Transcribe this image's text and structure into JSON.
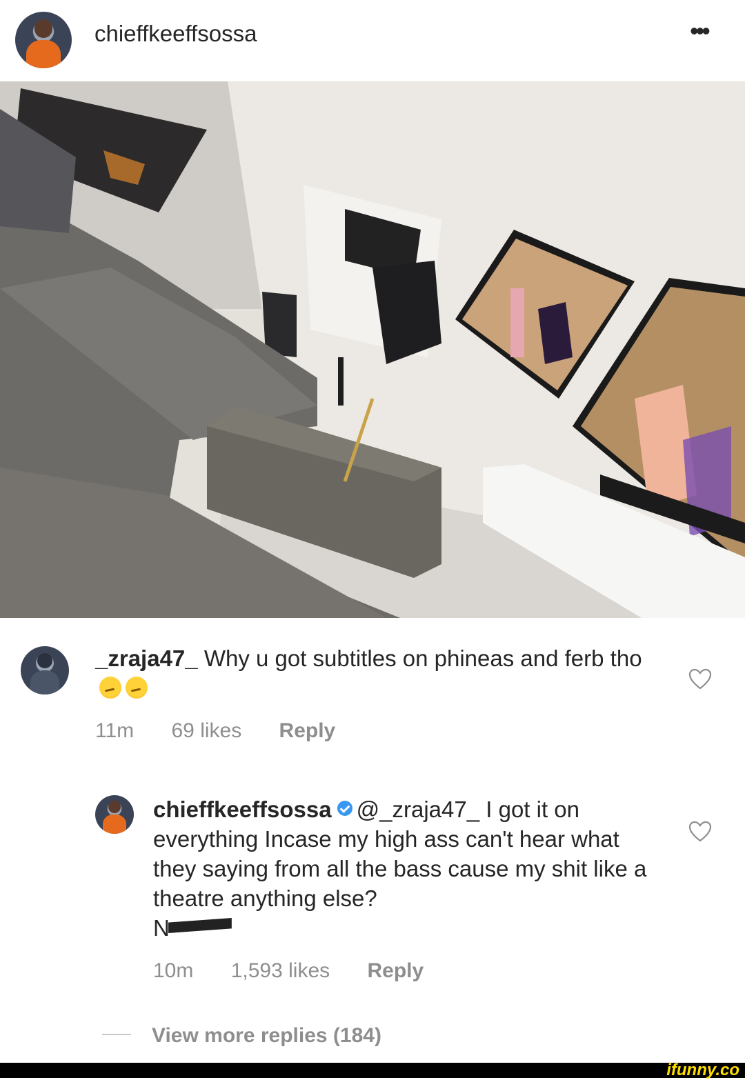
{
  "post": {
    "username": "chieffkeeffsossa",
    "more_label": "•••"
  },
  "comment1": {
    "username": "_zraja47_",
    "text": "Why u got subtitles on phineas and ferb tho",
    "time": "11m",
    "likes": "69 likes",
    "reply": "Reply"
  },
  "comment2": {
    "username": "chieffkeeffsossa",
    "mention": "@_zraja47_",
    "text": "I got it on everything Incase my high ass can't hear what they saying from all the bass  cause my shit like a theatre anything else?",
    "last_line": "N",
    "time": "10m",
    "likes": "1,593 likes",
    "reply": "Reply"
  },
  "view_more": "View more replies (184)",
  "watermark": "ifunny.co"
}
